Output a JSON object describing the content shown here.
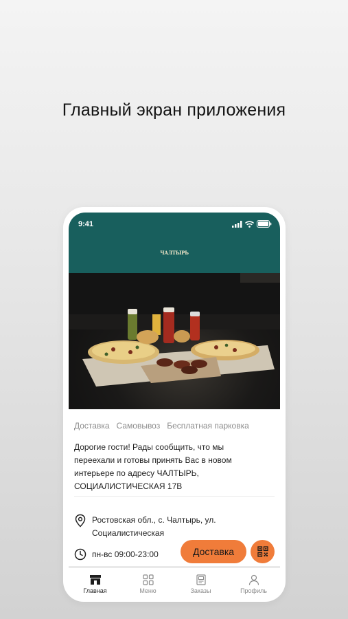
{
  "caption": "Главный экран приложения",
  "status_bar": {
    "time": "9:41"
  },
  "logo": {
    "text": "ЧАЛТЫРЬ"
  },
  "tags": [
    "Доставка",
    "Самовывоз",
    "Бесплатная парковка"
  ],
  "news": {
    "lines": [
      "Дорогие гости! Рады сообщить, что мы",
      "переехали и готовы принять Вас в новом",
      "интерьере по адресу ЧАЛТЫРЬ,",
      "СОЦИАЛИСТИЧЕСКАЯ 17В"
    ]
  },
  "address": {
    "line1": "Ростовская обл., с. Чалтырь, ул.",
    "line2": "Социалистическая"
  },
  "hours": "пн-вс  09:00-23:00",
  "buttons": {
    "delivery": "Доставка"
  },
  "tabbar": [
    {
      "label": "Главная",
      "icon": "shop-icon"
    },
    {
      "label": "Меню",
      "icon": "grid-icon"
    },
    {
      "label": "Заказы",
      "icon": "receipt-icon"
    },
    {
      "label": "Профиль",
      "icon": "user-icon"
    }
  ],
  "colors": {
    "header": "#185f5d",
    "accent": "#f07c3a"
  }
}
